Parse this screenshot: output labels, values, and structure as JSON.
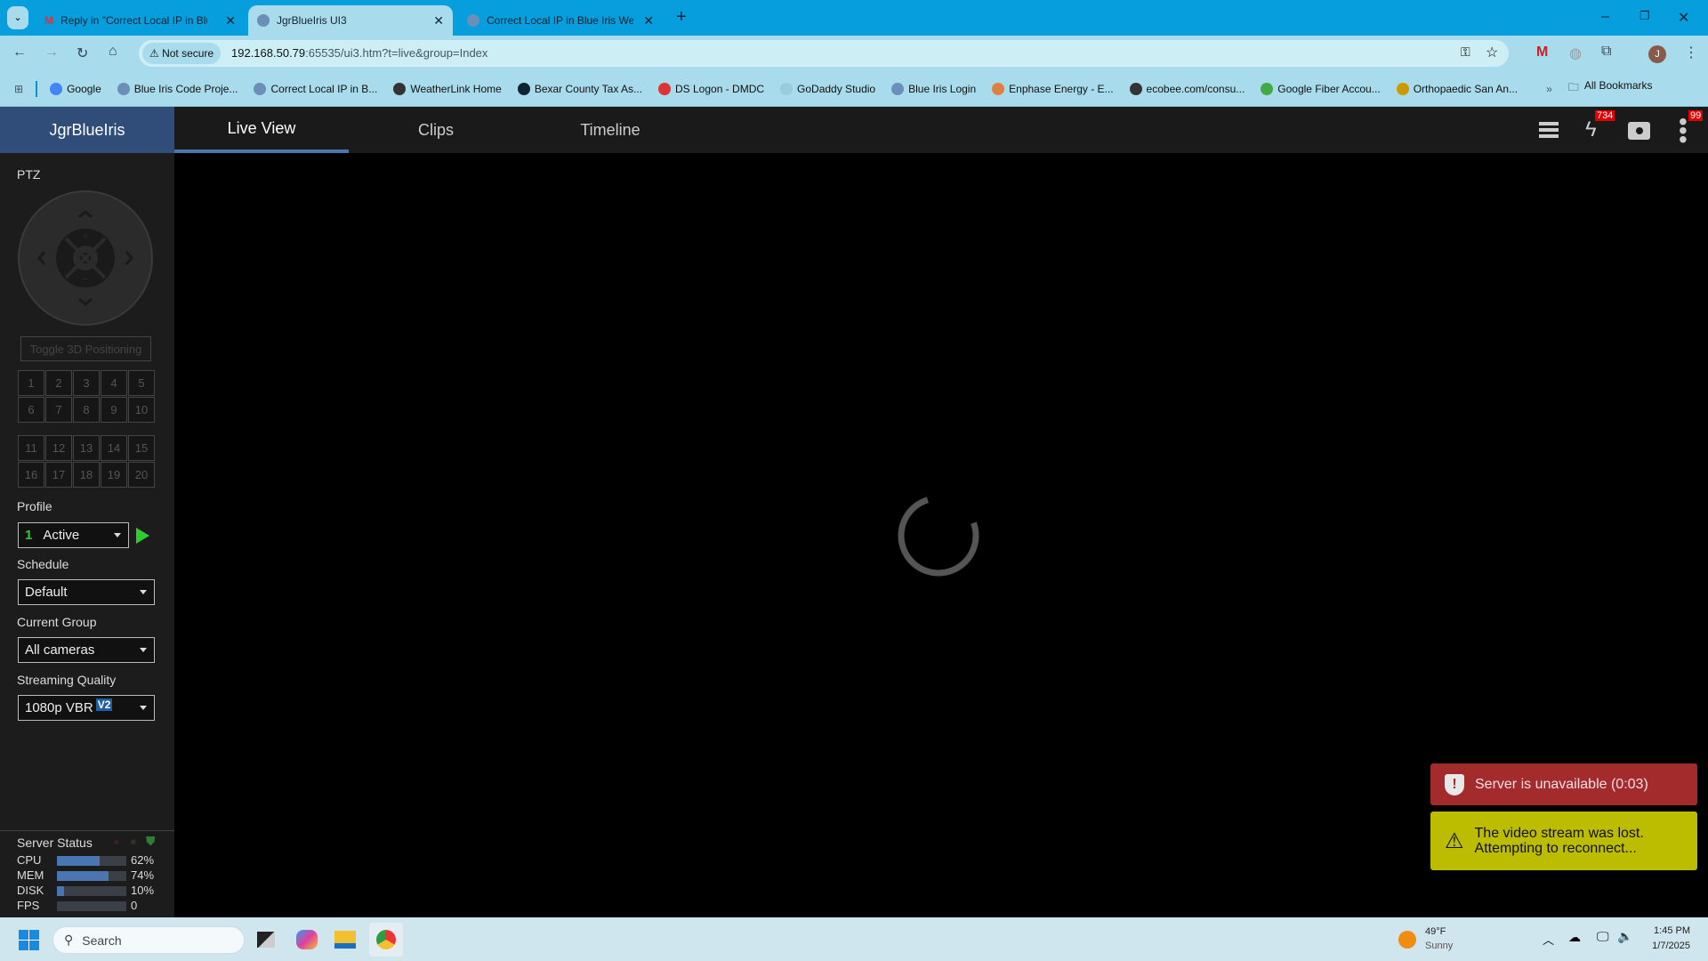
{
  "browser": {
    "tabs": [
      {
        "label": "Reply in \"Correct Local IP in Blu",
        "active": false
      },
      {
        "label": "JgrBlueIris UI3",
        "active": true
      },
      {
        "label": "Correct Local IP in Blue Iris Web",
        "active": false
      }
    ],
    "security_label": "Not secure",
    "url_host": "192.168.50.79",
    "url_rest": ":65535/ui3.htm?t=live&group=Index",
    "profile_initial": "J",
    "bookmarks": [
      "Google",
      "Blue Iris Code Proje...",
      "Correct Local IP in B...",
      "WeatherLink Home",
      "Bexar County Tax As...",
      "DS Logon - DMDC",
      "GoDaddy Studio",
      "Blue Iris Login",
      "Enphase Energy - E...",
      "ecobee.com/consu...",
      "Google Fiber Accou...",
      "Orthopaedic San An..."
    ],
    "overflow": "»",
    "all_bookmarks": "All Bookmarks"
  },
  "app": {
    "brand": "JgrBlueIris",
    "tabs": [
      "Live View",
      "Clips",
      "Timeline"
    ],
    "active_tab": "Live View",
    "alerts_badge": "734",
    "menu_badge": "99"
  },
  "sidebar": {
    "ptz_label": "PTZ",
    "toggle_3d": "Toggle 3D Positioning",
    "presets": [
      "1",
      "2",
      "3",
      "4",
      "5",
      "6",
      "7",
      "8",
      "9",
      "10",
      "11",
      "12",
      "13",
      "14",
      "15",
      "16",
      "17",
      "18",
      "19",
      "20"
    ],
    "profile_label": "Profile",
    "profile_num": "1",
    "profile_value": "Active",
    "schedule_label": "Schedule",
    "schedule_value": "Default",
    "group_label": "Current Group",
    "group_value": "All cameras",
    "quality_label": "Streaming Quality",
    "quality_value": "1080p VBR",
    "quality_badge": "V2",
    "server_status_label": "Server Status",
    "stats": [
      {
        "name": "CPU",
        "value": "62%",
        "pct": 62
      },
      {
        "name": "MEM",
        "value": "74%",
        "pct": 74
      },
      {
        "name": "DISK",
        "value": "10%",
        "pct": 10
      },
      {
        "name": "FPS",
        "value": "0",
        "pct": 0
      }
    ]
  },
  "toasts": {
    "error": "Server is unavailable (0:03)",
    "warning_line1": "The video stream was lost.",
    "warning_line2": "Attempting to reconnect..."
  },
  "taskbar": {
    "search_placeholder": "Search",
    "weather_temp": "49°F",
    "weather_desc": "Sunny",
    "time": "1:45 PM",
    "date": "1/7/2025"
  },
  "colors": {
    "brand_bg": "#2f4d78",
    "accent": "#4a75b0",
    "error": "#a32b2b",
    "warning": "#bcbc00",
    "badge": "#e00000"
  }
}
